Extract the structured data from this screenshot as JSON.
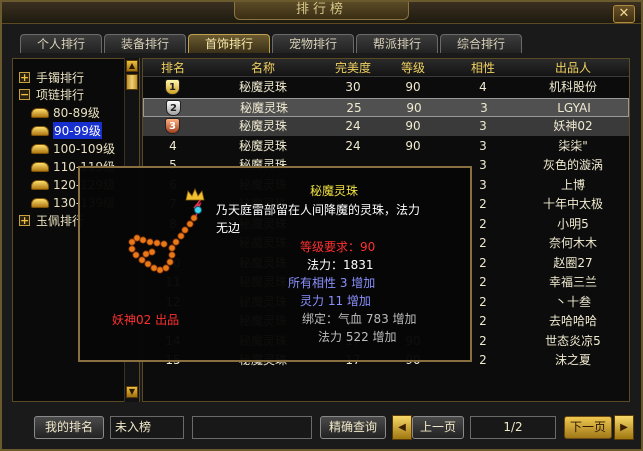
{
  "window": {
    "title": "排行榜",
    "close_glyph": "✕"
  },
  "tabs": [
    {
      "label": "个人排行"
    },
    {
      "label": "装备排行"
    },
    {
      "label": "首饰排行",
      "active": true
    },
    {
      "label": "宠物排行"
    },
    {
      "label": "帮派排行"
    },
    {
      "label": "综合排行"
    }
  ],
  "tree": [
    {
      "type": "group",
      "toggle": "+",
      "label": "手镯排行"
    },
    {
      "type": "group",
      "toggle": "−",
      "label": "项链排行"
    },
    {
      "type": "leaf",
      "label": "80-89级"
    },
    {
      "type": "leaf",
      "label": "90-99级",
      "selected": true
    },
    {
      "type": "leaf",
      "label": "100-109级"
    },
    {
      "type": "leaf",
      "label": "110-119级"
    },
    {
      "type": "leaf",
      "label": "120-129级"
    },
    {
      "type": "leaf",
      "label": "130-139级"
    },
    {
      "type": "group",
      "toggle": "+",
      "label": "玉佩排行"
    }
  ],
  "table": {
    "headers": [
      "排名",
      "名称",
      "完美度",
      "等级",
      "相性",
      "出品人"
    ],
    "rows": [
      [
        "1",
        "秘魔灵珠",
        "30",
        "90",
        "4",
        "机科股份"
      ],
      [
        "2",
        "秘魔灵珠",
        "25",
        "90",
        "3",
        "LGYAI"
      ],
      [
        "3",
        "秘魔灵珠",
        "24",
        "90",
        "3",
        "妖神02"
      ],
      [
        "4",
        "秘魔灵珠",
        "24",
        "90",
        "3",
        "柒柒\""
      ],
      [
        "5",
        "秘魔灵珠",
        "",
        "",
        "3",
        "灰色的漩涡"
      ],
      [
        "6",
        "秘魔灵珠",
        "",
        "",
        "3",
        "上博"
      ],
      [
        "7",
        "秘魔灵珠",
        "",
        "",
        "2",
        "十年中太极"
      ],
      [
        "8",
        "秘魔灵珠",
        "",
        "",
        "2",
        "小明5"
      ],
      [
        "9",
        "秘魔灵珠",
        "",
        "",
        "2",
        "奈何木木"
      ],
      [
        "10",
        "秘魔灵珠",
        "",
        "",
        "2",
        "赵圈27"
      ],
      [
        "11",
        "秘魔灵珠",
        "",
        "",
        "2",
        "幸福三兰"
      ],
      [
        "12",
        "秘魔灵珠",
        "",
        "",
        "2",
        "丶十叁"
      ],
      [
        "13",
        "秘魔灵珠",
        "",
        "",
        "2",
        "去哈哈哈"
      ],
      [
        "14",
        "秘魔灵珠",
        "17",
        "90",
        "2",
        "世态炎凉5"
      ],
      [
        "15",
        "秘魔灵珠",
        "17",
        "90",
        "2",
        "沫之夏"
      ]
    ]
  },
  "tooltip": {
    "item_name": "秘魔灵珠",
    "description_line1": "乃天庭雷部留在人间降魔的灵珠，法力",
    "description_line2": "无边",
    "level_requirement": "等级要求：90",
    "mana": "法力：1831",
    "attr1": "所有相性 3 增加",
    "attr2": "灵力 11 增加",
    "bind1": "绑定：气血 783 增加",
    "bind2": "法力 522 增加",
    "maker": "妖神02 出品",
    "colors": {
      "name": "#f0e040",
      "white": "#ffffff",
      "red": "#ff3030",
      "blue": "#8a90ff",
      "gray": "#bcbcbc"
    }
  },
  "bottom": {
    "my_rank_label": "我的排名",
    "my_rank_value": "未入榜",
    "search_value": "",
    "search_label": "精确查询",
    "prev_label": "上一页",
    "page": "1/2",
    "next_label": "下一页",
    "prev_glyph": "◀",
    "next_glyph": "▶"
  }
}
